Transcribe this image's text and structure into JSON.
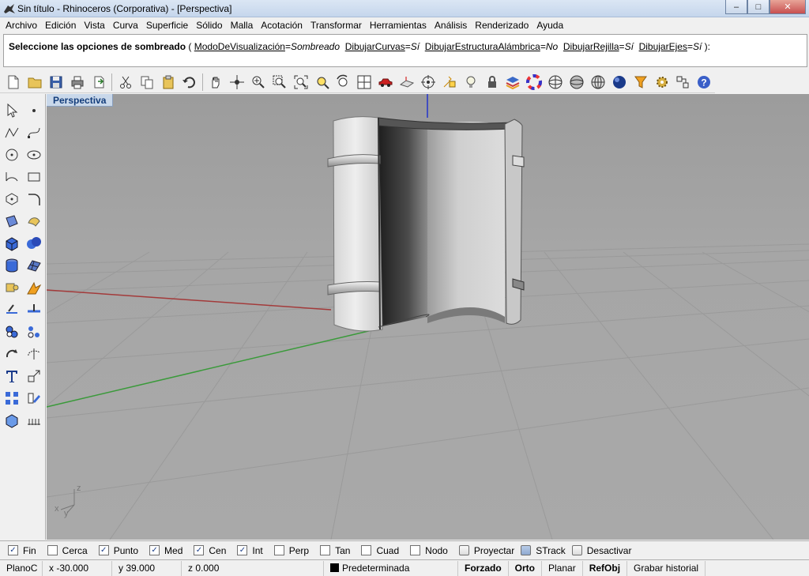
{
  "window": {
    "title": "Sin título - Rhinoceros (Corporativa) - [Perspectiva]",
    "minimize": "–",
    "maximize": "□",
    "close": "✕"
  },
  "menu": [
    "Archivo",
    "Edición",
    "Vista",
    "Curva",
    "Superficie",
    "Sólido",
    "Malla",
    "Acotación",
    "Transformar",
    "Herramientas",
    "Análisis",
    "Renderizado",
    "Ayuda"
  ],
  "command": {
    "prompt_lead": "Seleccione las opciones de sombreado",
    "prompt_rest": " ( ",
    "opt1_key": "ModoDeVisualización",
    "opt1_eq": "=",
    "opt1_val": "Sombreado",
    "opt2_key": "DibujarCurvas",
    "opt2_eq": "=",
    "opt2_val": "Sí",
    "opt3_key": "DibujarEstructuraAlámbrica",
    "opt3_eq": "=",
    "opt3_val": "No",
    "opt4_key": "DibujarRejilla",
    "opt4_eq": "=",
    "opt4_val": "Sí",
    "opt5_key": "DibujarEjes",
    "opt5_eq": "=",
    "opt5_val": "Sí",
    "prompt_end": " ):"
  },
  "viewport": {
    "tab_label": "Perspectiva",
    "axis_z": "z",
    "axis_x": "x",
    "axis_y": "y"
  },
  "osnaps": [
    {
      "label": "Fin",
      "checked": true
    },
    {
      "label": "Cerca",
      "checked": false
    },
    {
      "label": "Punto",
      "checked": true
    },
    {
      "label": "Med",
      "checked": true
    },
    {
      "label": "Cen",
      "checked": true
    },
    {
      "label": "Int",
      "checked": true
    },
    {
      "label": "Perp",
      "checked": false
    },
    {
      "label": "Tan",
      "checked": false
    },
    {
      "label": "Cuad",
      "checked": false
    },
    {
      "label": "Nodo",
      "checked": false
    }
  ],
  "osnap_buttons": [
    {
      "label": "Proyectar",
      "on": false
    },
    {
      "label": "STrack",
      "on": true
    },
    {
      "label": "Desactivar",
      "on": false
    }
  ],
  "status": {
    "cplane": "PlanoC",
    "x": "x -30.000",
    "y": "y 39.000",
    "z": "z 0.000",
    "layer": "Predeterminada",
    "snap": "Forzado",
    "ortho": "Orto",
    "planar": "Planar",
    "osnap": "RefObj",
    "history": "Grabar historial"
  },
  "colors": {
    "viewport_bg": "#a3a3a3",
    "x_axis": "#a33a3a",
    "y_axis": "#3a9a3a",
    "z_axis": "#2233cc",
    "tab_bg": "#c9d8ea"
  }
}
